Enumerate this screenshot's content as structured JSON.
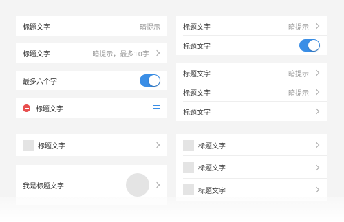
{
  "left": {
    "card1": {
      "title": "标题文字",
      "hint": "暗提示"
    },
    "card2": {
      "title": "标题文字",
      "hint": "暗提示，最多10字"
    },
    "card3": {
      "title": "最多六个字"
    },
    "card4": {
      "title": "标题文字"
    },
    "card5": {
      "title": "标题文字"
    },
    "card6": {
      "title": "我是标题文字"
    }
  },
  "right": {
    "group1": [
      {
        "title": "标题文字",
        "hint": "暗提示"
      },
      {
        "title": "标题文字"
      }
    ],
    "group2": [
      {
        "title": "标题文字",
        "hint": "暗提示"
      },
      {
        "title": "标题文字",
        "hint": "暗提示"
      },
      {
        "title": "标题文字"
      }
    ],
    "group3": [
      {
        "title": "标题文字"
      },
      {
        "title": "标题文字"
      },
      {
        "title": "标题文字"
      }
    ]
  },
  "colors": {
    "accent": "#3a8ee6",
    "danger": "#e84e4e",
    "background": "#f4f4f4"
  },
  "icons": [
    "chevron-right-icon",
    "delete-icon",
    "menu-icon",
    "image-placeholder-icon",
    "avatar-placeholder"
  ]
}
